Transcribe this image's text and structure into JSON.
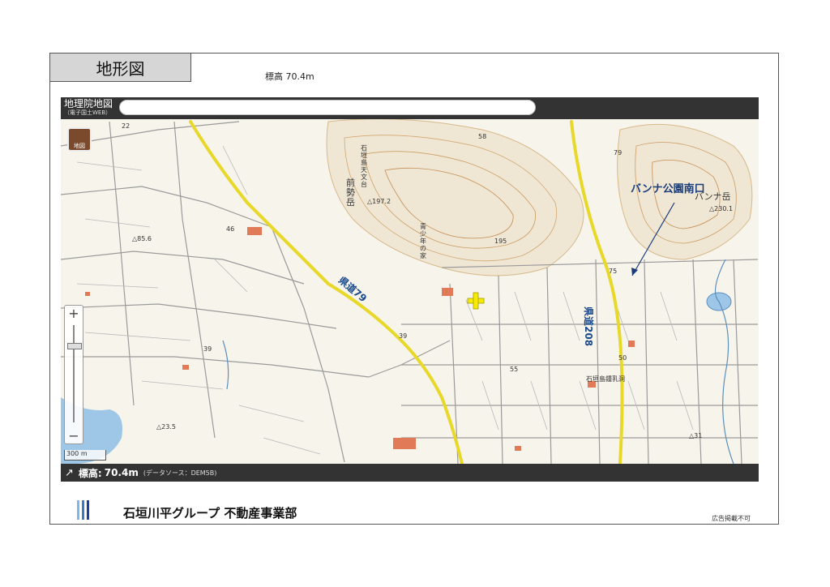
{
  "page": {
    "title": "地形図",
    "elevation_top": "標高 70.4m",
    "company": "石垣川平グループ 不動産事業部",
    "note": "広告掲載不可",
    "logo_colors": [
      "#7fb6e8",
      "#3a7cc7",
      "#1a3fa0"
    ]
  },
  "map": {
    "brand": "地理院地図",
    "brand_sub": "（電子国土WEB）",
    "layer_button": "地図",
    "zoom_in": "+",
    "zoom_out": "−",
    "scale": "300 m",
    "footer_label": "標高:",
    "footer_value": "70.4m",
    "footer_source": "(データソース：DEM5B)",
    "arrow_icon": "north-arrow-icon",
    "marker_color": "#f5ea00",
    "labels": {
      "l22": "22",
      "l58": "58",
      "l79": "79",
      "observatory": "石垣島天文台",
      "maese": "前勢岳",
      "p1972": "△197.2",
      "p195": "195",
      "youth": "青少年の家",
      "banna": "バンナ岳",
      "p2301": "△230.1",
      "p75": "75",
      "p85": "△85.6",
      "p46": "46",
      "p39a": "39",
      "p39b": "39",
      "p55": "55",
      "p50": "50",
      "p235": "△23.5",
      "p31": "△31",
      "cave": "石垣島鍾乳洞"
    },
    "routes": {
      "r79": "県道79",
      "r208": "県道208"
    },
    "annotation": "バンナ公園南口"
  }
}
